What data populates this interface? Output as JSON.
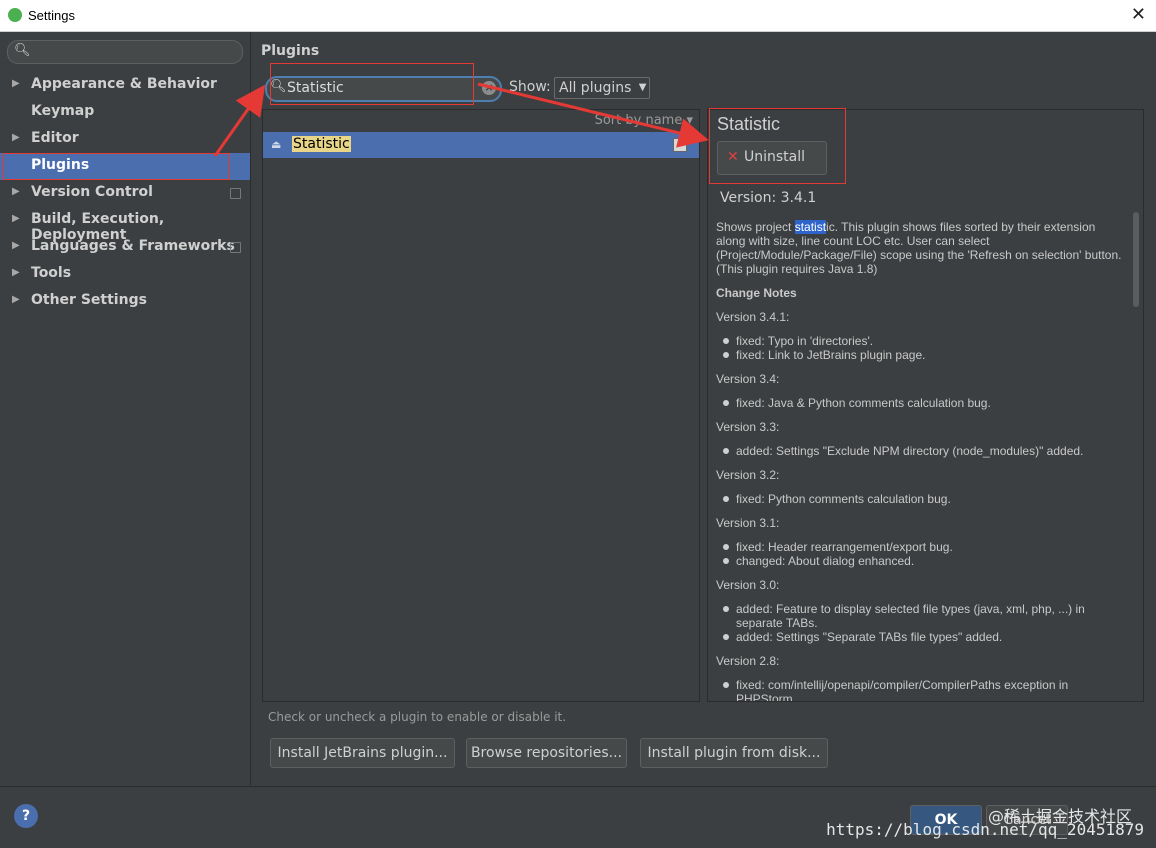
{
  "window": {
    "title": "Settings"
  },
  "sidebar": {
    "items": [
      {
        "label": "Appearance & Behavior",
        "arrow": true,
        "badge": false
      },
      {
        "label": "Keymap",
        "arrow": false,
        "badge": false
      },
      {
        "label": "Editor",
        "arrow": true,
        "badge": false
      },
      {
        "label": "Plugins",
        "arrow": false,
        "badge": false,
        "selected": true
      },
      {
        "label": "Version Control",
        "arrow": true,
        "badge": true
      },
      {
        "label": "Build, Execution, Deployment",
        "arrow": true,
        "badge": false
      },
      {
        "label": "Languages & Frameworks",
        "arrow": true,
        "badge": true
      },
      {
        "label": "Tools",
        "arrow": true,
        "badge": false
      },
      {
        "label": "Other Settings",
        "arrow": true,
        "badge": false
      }
    ]
  },
  "main": {
    "title": "Plugins",
    "search_value": "Statistic",
    "show_label": "Show:",
    "show_value": "All plugins",
    "sort_label": "Sort by name",
    "plugin_list": [
      {
        "name": "Statistic",
        "enabled": true
      }
    ],
    "hint": "Check or uncheck a plugin to enable or disable it.",
    "buttons": {
      "install_jetbrains": "Install JetBrains plugin...",
      "browse": "Browse repositories...",
      "install_disk": "Install plugin from disk..."
    }
  },
  "detail": {
    "title": "Statistic",
    "uninstall_label": "Uninstall",
    "version": "Version: 3.4.1",
    "desc_before": "Shows project ",
    "desc_highlight": "statist",
    "desc_after": "ic. This plugin shows files sorted by their extension along with size, line count LOC etc. User can select (Project/Module/Package/File) scope using the 'Refresh on selection' button. (This plugin requires Java 1.8)",
    "change_notes_title": "Change Notes",
    "versions": [
      {
        "label": "Version 3.4.1:",
        "items": [
          "fixed: Typo in 'directories'.",
          "fixed: Link to JetBrains plugin page."
        ]
      },
      {
        "label": "Version 3.4:",
        "items": [
          "fixed: Java & Python comments calculation bug."
        ]
      },
      {
        "label": "Version 3.3:",
        "items": [
          "added: Settings \"Exclude NPM directory (node_modules)\" added."
        ]
      },
      {
        "label": "Version 3.2:",
        "items": [
          "fixed: Python comments calculation bug."
        ]
      },
      {
        "label": "Version 3.1:",
        "items": [
          "fixed: Header rearrangement/export bug.",
          "changed: About dialog enhanced."
        ]
      },
      {
        "label": "Version 3.0:",
        "items": [
          "added: Feature to display selected file types (java, xml, php, ...) in separate TABs.",
          "added: Settings \"Separate TABs file types\" added."
        ]
      },
      {
        "label": "Version 2.8:",
        "items": [
          "fixed: com/intellij/openapi/compiler/CompilerPaths exception in PHPStorm."
        ]
      }
    ]
  },
  "footer": {
    "help": "?",
    "ok": "OK",
    "cancel": "Cancel",
    "watermark_1": "@稀土掘金技术社区",
    "watermark_2": "https://blog.csdn.net/qq_20451879"
  },
  "colors": {
    "selection": "#4b6eaf",
    "annotation": "#e53935",
    "background": "#3c3f41"
  }
}
